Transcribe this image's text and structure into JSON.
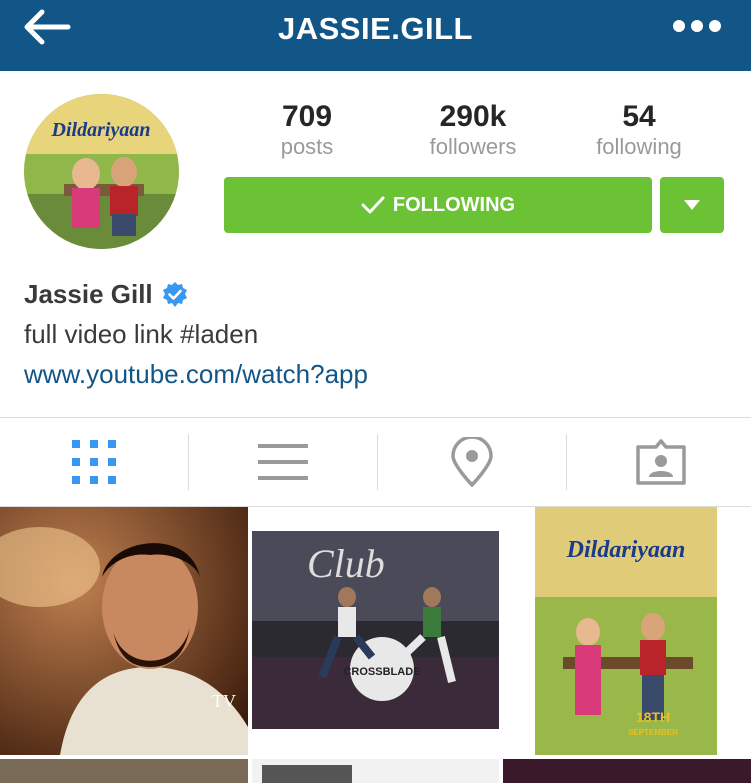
{
  "header": {
    "title": "JASSIE.GILL",
    "back_icon": "arrow-left-icon",
    "more_icon": "more-horizontal-icon",
    "bg_color": "#125688"
  },
  "profile": {
    "stats": [
      {
        "value": "709",
        "label": "posts"
      },
      {
        "value": "290k",
        "label": "followers"
      },
      {
        "value": "54",
        "label": "following"
      }
    ],
    "follow_button_label": "FOLLOWING",
    "name": "Jassie Gill",
    "bio": "full video link #laden",
    "link": "www.youtube.com/watch?app",
    "avatar_poster_text": "Dildariyaan"
  },
  "tabs": [
    {
      "name": "grid-view",
      "icon": "grid-icon",
      "active": true
    },
    {
      "name": "list-view",
      "icon": "list-icon",
      "active": false
    },
    {
      "name": "location",
      "icon": "location-pin-icon",
      "active": false
    },
    {
      "name": "tagged",
      "icon": "tagged-person-icon",
      "active": false
    }
  ],
  "posts": [
    {
      "kind": "portrait-photo",
      "watermark": "TV"
    },
    {
      "kind": "stage-dance-photo",
      "stage_text": "Club",
      "drum_text": "CROSSBLADE"
    },
    {
      "kind": "movie-poster",
      "title": "Dildariyaan",
      "date_line1": "18TH",
      "date_line2": "SEPTEMBER"
    }
  ],
  "colors": {
    "accent_green": "#6bc235",
    "link_blue": "#125688",
    "verified_blue": "#3897f0",
    "muted_gray": "#9a9a9a"
  }
}
